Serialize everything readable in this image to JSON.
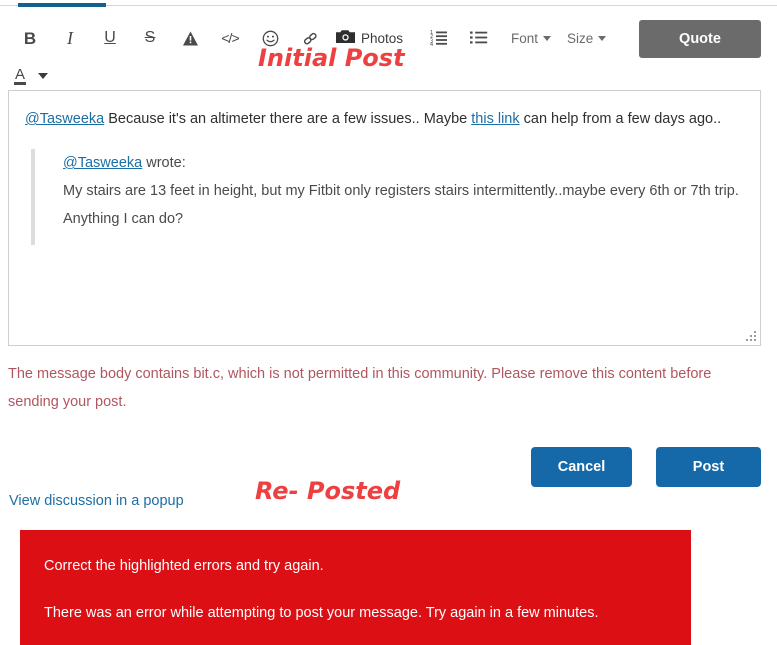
{
  "colors": {
    "active_tab": "#14608e",
    "accent_blue": "#1569a8",
    "link_blue": "#1c6ea4",
    "annotation_red": "#ee4040",
    "error_banner_red": "#dc0f15",
    "validation_text": "#b0565f",
    "quote_button_gray": "#6b6b6b"
  },
  "toolbar": {
    "buttons": [
      {
        "name": "bold-button",
        "glyph": "B",
        "title": "Bold"
      },
      {
        "name": "italic-button",
        "glyph": "I",
        "title": "Italic"
      },
      {
        "name": "underline-button",
        "glyph": "U",
        "title": "Underline"
      },
      {
        "name": "strikethrough-button",
        "glyph": "S",
        "title": "Strikethrough"
      },
      {
        "name": "clear-formatting-button",
        "glyph": "A",
        "title": "Clear formatting"
      },
      {
        "name": "code-button",
        "glyph": "</>",
        "title": "Insert code"
      },
      {
        "name": "emoji-button",
        "glyph": "☺",
        "title": "Insert emoji"
      },
      {
        "name": "link-button",
        "glyph": "🔗",
        "title": "Insert link"
      }
    ],
    "photos_label": "Photos",
    "numbered_list_title": "Numbered list",
    "bullet_list_title": "Bulleted list",
    "font_label": "Font",
    "size_label": "Size",
    "quote_label": "Quote",
    "text_color_glyph": "A",
    "text_color_title": "Text color"
  },
  "annotations": {
    "initial_post": "Initial Post",
    "re_posted": "Re- Posted"
  },
  "message_body": {
    "mention": "@Tasweeka",
    "text_before_link": " Because it's an altimeter there are a few issues.. Maybe ",
    "link_text": "this link",
    "text_after_link": " can help from a few days ago..",
    "quote": {
      "author": "@Tasweeka",
      "wrote_label": " wrote:",
      "text": "My stairs are 13 feet in height, but my Fitbit only registers stairs intermittently..maybe every 6th or 7th trip. Anything I can do?"
    }
  },
  "validation": {
    "message": "The message body contains bit.c, which is not permitted in this community. Please remove this content before sending your post."
  },
  "actions": {
    "cancel_label": "Cancel",
    "post_label": "Post"
  },
  "popup_link": {
    "label": "View discussion in a popup"
  },
  "error_banner": {
    "line1": "Correct the highlighted errors and try again.",
    "line2": "There was an error while attempting to post your message. Try again in a few minutes."
  }
}
